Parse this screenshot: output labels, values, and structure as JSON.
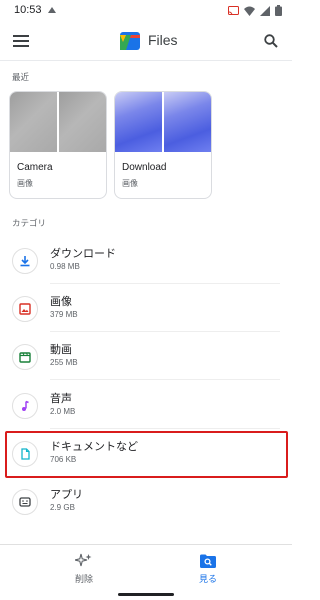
{
  "status_bar": {
    "time": "10:53"
  },
  "app_bar": {
    "title": "Files"
  },
  "recent": {
    "label": "最近",
    "cards": [
      {
        "title": "Camera",
        "subtitle": "画像"
      },
      {
        "title": "Download",
        "subtitle": "画像"
      }
    ]
  },
  "categories": {
    "label": "カテゴリ",
    "items": [
      {
        "title": "ダウンロード",
        "size": "0.98 MB",
        "icon": "download-icon",
        "color": "#1a73e8"
      },
      {
        "title": "画像",
        "size": "379 MB",
        "icon": "image-icon",
        "color": "#d93025"
      },
      {
        "title": "動画",
        "size": "255 MB",
        "icon": "video-icon",
        "color": "#188038"
      },
      {
        "title": "音声",
        "size": "2.0 MB",
        "icon": "audio-icon",
        "color": "#a142f4"
      },
      {
        "title": "ドキュメントなど",
        "size": "706 KB",
        "icon": "document-icon",
        "color": "#12b5cb"
      },
      {
        "title": "アプリ",
        "size": "2.9 GB",
        "icon": "apps-icon",
        "color": "#3c4043"
      }
    ]
  },
  "bottom_nav": {
    "items": [
      {
        "label": "削除",
        "icon": "sparkle-clean-icon",
        "active": false
      },
      {
        "label": "見る",
        "icon": "browse-folder-icon",
        "active": true
      }
    ]
  },
  "colors": {
    "accent": "#1a73e8",
    "highlight": "#d91c1c"
  }
}
